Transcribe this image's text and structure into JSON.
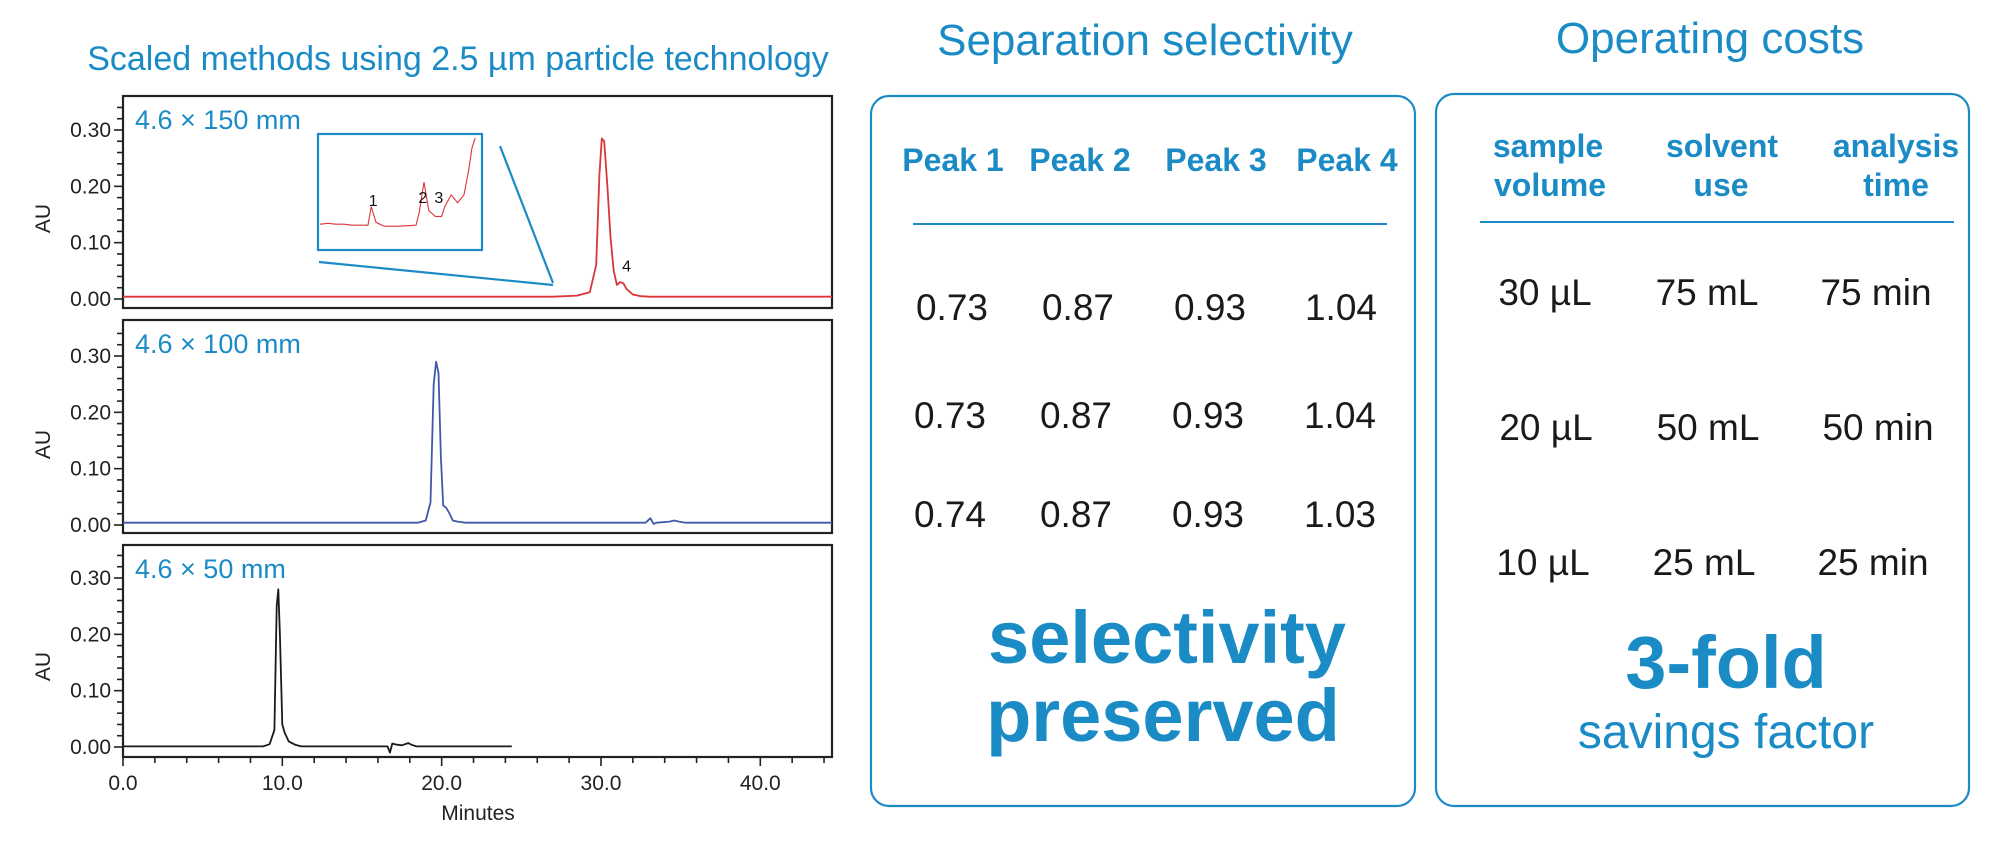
{
  "colors": {
    "accent": "#1b8bc6",
    "trace_150": "#d9353a",
    "trace_100": "#3f5aa6",
    "trace_50": "#1a1a1a",
    "frame": "#222222"
  },
  "chart_data": [
    {
      "type": "line",
      "title": "Scaled methods using 2.5 µm particle technology",
      "xlabel": "Minutes",
      "ylabel": "AU",
      "xlim": [
        0,
        44.5
      ],
      "ylim": [
        -0.02,
        0.355
      ],
      "x_ticks": [
        "0.0",
        "10.0",
        "20.0",
        "30.0",
        "40.0"
      ],
      "y_ticks": [
        "0.00",
        "0.10",
        "0.20",
        "0.30"
      ],
      "grid": false,
      "panels": [
        {
          "name": "4.6 × 150 mm",
          "label": "4.6 × 150 mm",
          "color_key": "trace_150",
          "x": [
            0,
            27.0,
            28.5,
            29.3,
            29.7,
            29.9,
            30.05,
            30.2,
            30.4,
            30.6,
            30.8,
            31.0,
            31.2,
            31.4,
            31.6,
            32.0,
            32.5,
            33.0,
            44.5
          ],
          "y": [
            0.004,
            0.004,
            0.006,
            0.012,
            0.06,
            0.22,
            0.285,
            0.28,
            0.2,
            0.11,
            0.05,
            0.025,
            0.03,
            0.028,
            0.018,
            0.008,
            0.005,
            0.004,
            0.004
          ],
          "peak_labels": [
            {
              "text": "4",
              "x": 31.2,
              "y": 0.045
            }
          ],
          "inset": {
            "peak_labels": [
              "1",
              "2",
              "3"
            ],
            "x": [
              0,
              0.05,
              0.1,
              0.15,
              0.2,
              0.25,
              0.3,
              0.32,
              0.35,
              0.4,
              0.5,
              0.6,
              0.62,
              0.65,
              0.68,
              0.72,
              0.76,
              0.78,
              0.82,
              0.86,
              0.9,
              0.93,
              0.95,
              0.97
            ],
            "y": [
              0.12,
              0.13,
              0.12,
              0.12,
              0.11,
              0.11,
              0.11,
              0.3,
              0.14,
              0.1,
              0.1,
              0.11,
              0.24,
              0.55,
              0.26,
              0.2,
              0.2,
              0.3,
              0.42,
              0.34,
              0.42,
              0.68,
              0.9,
              1.0
            ]
          }
        },
        {
          "name": "4.6 × 100 mm",
          "label": "4.6 × 100 mm",
          "color_key": "trace_100",
          "x": [
            0,
            18.5,
            19.0,
            19.3,
            19.5,
            19.65,
            19.8,
            19.95,
            20.1,
            20.3,
            20.5,
            20.7,
            21.0,
            21.5,
            32.8,
            33.1,
            33.3,
            33.5,
            34.3,
            34.6,
            34.9,
            35.3,
            44.5
          ],
          "y": [
            0.004,
            0.004,
            0.008,
            0.04,
            0.25,
            0.29,
            0.27,
            0.12,
            0.035,
            0.03,
            0.02,
            0.008,
            0.006,
            0.004,
            0.004,
            0.012,
            0.002,
            0.004,
            0.006,
            0.008,
            0.006,
            0.004,
            0.004
          ]
        },
        {
          "name": "4.6 × 50 mm",
          "label": "4.6 × 50 mm",
          "color_key": "trace_50",
          "x": [
            0,
            8.8,
            9.2,
            9.5,
            9.65,
            9.75,
            9.85,
            10.0,
            10.15,
            10.4,
            10.8,
            11.2,
            16.6,
            16.75,
            16.9,
            17.2,
            17.5,
            17.9,
            18.1,
            18.4,
            24.4
          ],
          "y": [
            0.001,
            0.001,
            0.005,
            0.03,
            0.25,
            0.28,
            0.2,
            0.04,
            0.025,
            0.01,
            0.004,
            0.001,
            0.001,
            -0.01,
            0.006,
            0.004,
            0.003,
            0.007,
            0.004,
            0.001,
            0.001
          ]
        }
      ]
    },
    {
      "type": "table",
      "title": "Separation selectivity",
      "columns": [
        "Peak 1",
        "Peak 2",
        "Peak 3",
        "Peak 4"
      ],
      "rows": [
        [
          "0.73",
          "0.87",
          "0.93",
          "1.04"
        ],
        [
          "0.73",
          "0.87",
          "0.93",
          "1.04"
        ],
        [
          "0.74",
          "0.87",
          "0.93",
          "1.03"
        ]
      ],
      "highlight": [
        "selectivity",
        "preserved"
      ]
    },
    {
      "type": "table",
      "title": "Operating costs",
      "columns": [
        [
          "sample",
          "volume"
        ],
        [
          "solvent",
          "use"
        ],
        [
          "analysis",
          "time"
        ]
      ],
      "rows": [
        [
          "30 µL",
          "75 mL",
          "75 min"
        ],
        [
          "20 µL",
          "50 mL",
          "50 min"
        ],
        [
          "10 µL",
          "25 mL",
          "25 min"
        ]
      ],
      "highlight": "3-fold",
      "highlight_sub": "savings factor"
    }
  ],
  "left": {
    "title": "Scaled methods using 2.5 µm particle technology",
    "ylabel": "AU",
    "xlabel": "Minutes",
    "panel_labels": [
      "4.6 × 150 mm",
      "4.6 × 100 mm",
      "4.6 × 50 mm"
    ],
    "y_ticks": [
      "0.30",
      "0.20",
      "0.10",
      "0.00"
    ],
    "x_ticks": [
      "0.0",
      "10.0",
      "20.0",
      "30.0",
      "40.0"
    ],
    "inset_labels": [
      "1",
      "2",
      "3"
    ],
    "peak4_label": "4"
  },
  "selectivity": {
    "title": "Separation selectivity",
    "headers": [
      "Peak 1",
      "Peak 2",
      "Peak 3",
      "Peak 4"
    ],
    "rows": [
      [
        "0.73",
        "0.87",
        "0.93",
        "1.04"
      ],
      [
        "0.73",
        "0.87",
        "0.93",
        "1.04"
      ],
      [
        "0.74",
        "0.87",
        "0.93",
        "1.03"
      ]
    ],
    "summary_line1": "selectivity",
    "summary_line2": "preserved"
  },
  "costs": {
    "title": "Operating costs",
    "headers": [
      [
        "sample",
        "volume"
      ],
      [
        "solvent",
        "use"
      ],
      [
        "analysis",
        "time"
      ]
    ],
    "rows": [
      [
        "30 µL",
        "75 mL",
        "75 min"
      ],
      [
        "20 µL",
        "50 mL",
        "50 min"
      ],
      [
        "10 µL",
        "25 mL",
        "25 min"
      ]
    ],
    "summary_big": "3-fold",
    "summary_sub": "savings factor"
  }
}
